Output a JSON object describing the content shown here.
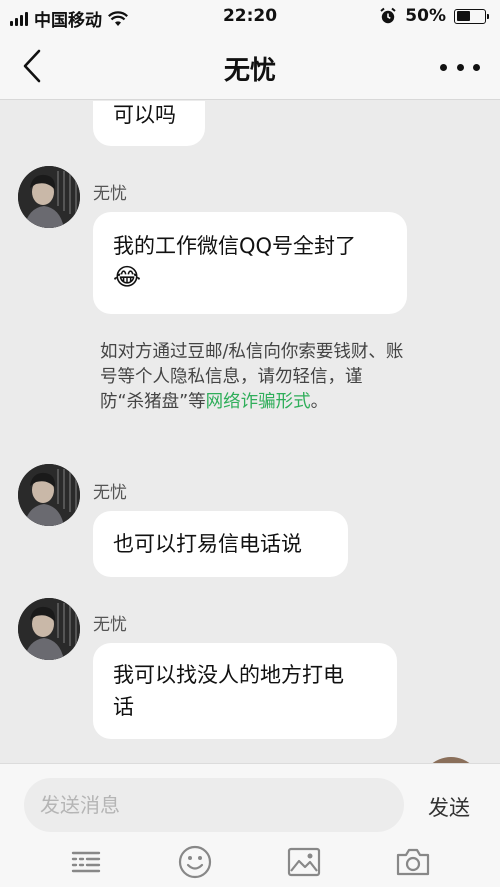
{
  "status_bar": {
    "carrier": "中国移动",
    "time": "22:20",
    "battery_percent": "50%",
    "battery_level": 0.5
  },
  "nav": {
    "title": "无忧",
    "back_icon": "chevron-left-icon",
    "more_icon": "more-dots-icon"
  },
  "messages": [
    {
      "text": "可以吗"
    },
    {
      "sender": "无忧",
      "text_line1": "我的工作微信QQ号全封了",
      "emoji": "😂"
    },
    {
      "sender": "无忧",
      "text": "也可以打易信电话说"
    },
    {
      "sender": "无忧",
      "text_line1": "我可以找没人的地方打电",
      "text_line2": "话"
    }
  ],
  "notice": {
    "text": "如对方通过豆邮/私信向你索要钱财、账号等个人隐私信息，请勿轻信，谨防“杀猪盘”等",
    "link_text": "网络诈骗形式",
    "end": "。"
  },
  "input": {
    "placeholder": "发送消息",
    "value": "",
    "send_label": "发送"
  },
  "toolbar": [
    "keyboard-icon",
    "emoji-icon",
    "image-icon",
    "camera-icon"
  ],
  "colors": {
    "background": "#ebebeb",
    "bubble": "#ffffff",
    "link": "#2fae5a"
  }
}
